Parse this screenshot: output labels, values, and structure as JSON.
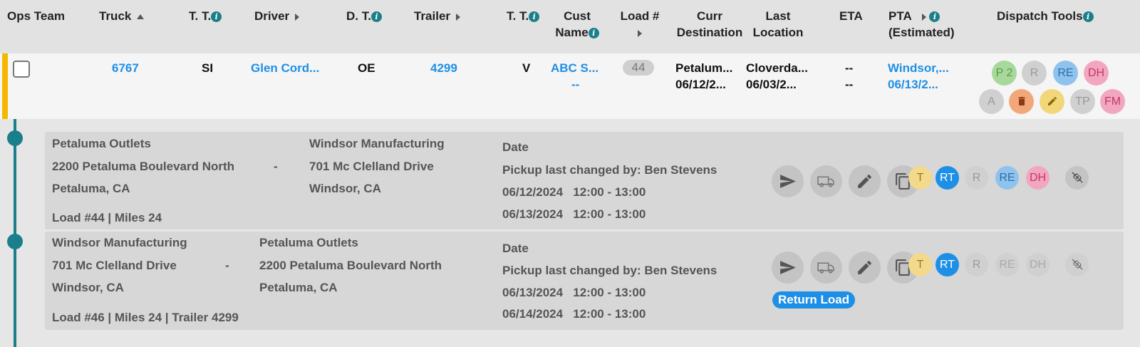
{
  "header": {
    "ops_team": "Ops Team",
    "truck": "Truck",
    "tt1": "T. T.",
    "driver": "Driver",
    "dt": "D. T.",
    "trailer": "Trailer",
    "tt2": "T. T.",
    "cust_name_1": "Cust",
    "cust_name_2": "Name",
    "load_num": "Load #",
    "curr_dest_1": "Curr",
    "curr_dest_2": "Destination",
    "last_loc_1": "Last",
    "last_loc_2": "Location",
    "eta": "ETA",
    "pta_1": "PTA",
    "pta_2": "(Estimated)",
    "dispatch_tools": "Dispatch Tools"
  },
  "row": {
    "truck": "6767",
    "tt1": "SI",
    "driver": "Glen Cord...",
    "dt": "OE",
    "trailer": "4299",
    "tt2": "V",
    "cust_name": "ABC S...",
    "cust_sub": "--",
    "load_num": "44",
    "curr_dest": "Petalum...",
    "curr_date": "06/12/2...",
    "last_loc": "Cloverda...",
    "last_date": "06/03/2...",
    "eta_1": "--",
    "eta_2": "--",
    "pta_loc": "Windsor,...",
    "pta_date": "06/13/2..."
  },
  "dispatch_pills": [
    {
      "label": "P 2",
      "bg": "#a8d89a",
      "fg": "#5a9a48"
    },
    {
      "label": "R",
      "bg": "#d0d0d0",
      "fg": "#999999"
    },
    {
      "label": "RE",
      "bg": "#8fc3ee",
      "fg": "#2a6ea8"
    },
    {
      "label": "DH",
      "bg": "#f2a6c0",
      "fg": "#c03a6a"
    },
    {
      "label": "A",
      "bg": "#d0d0d0",
      "fg": "#999999"
    },
    {
      "label": "trash-icon",
      "bg": "#f2a77a",
      "fg": "#a0522d"
    },
    {
      "label": "pencil-icon",
      "bg": "#f2d77a",
      "fg": "#8a6a00"
    },
    {
      "label": "TP",
      "bg": "#d0d0d0",
      "fg": "#999999"
    },
    {
      "label": "FM",
      "bg": "#f2a6c0",
      "fg": "#c03a6a"
    }
  ],
  "stops": [
    {
      "from_name": "Petaluma Outlets",
      "from_street": "2200 Petaluma Boulevard North",
      "from_city": "Petaluma, CA",
      "dash": "-",
      "to_name": "Windsor Manufacturing",
      "to_street": "701 Mc Clelland Drive",
      "to_city": "Windsor, CA",
      "meta": "Load #44 | Miles 24",
      "date_label": "Date",
      "changed_by": "Pickup last changed by: Ben Stevens",
      "date_1": "06/12/2024   12:00 - 13:00",
      "date_2": "06/13/2024   12:00 - 13:00",
      "pills": [
        {
          "label": "T",
          "bg": "#f2d98c",
          "fg": "#9a7a20"
        },
        {
          "label": "RT",
          "bg": "#1e8fe6",
          "fg": "#ffffff"
        },
        {
          "label": "R",
          "bg": "#d0d0d0",
          "fg": "#999999"
        },
        {
          "label": "RE",
          "bg": "#8fc3ee",
          "fg": "#2a6ea8"
        },
        {
          "label": "DH",
          "bg": "#f2a6c0",
          "fg": "#c03a6a"
        }
      ]
    },
    {
      "from_name": "Windsor Manufacturing",
      "from_street": "701 Mc Clelland Drive",
      "from_city": "Windsor, CA",
      "dash": "-",
      "to_name": "Petaluma Outlets",
      "to_street": "2200 Petaluma Boulevard North",
      "to_city": "Petaluma, CA",
      "meta": "Load #46 | Miles 24 | Trailer 4299",
      "date_label": "Date",
      "changed_by": "Pickup last changed by: Ben Stevens",
      "date_1": "06/13/2024   12:00 - 13:00",
      "date_2": "06/14/2024   12:00 - 13:00",
      "pills": [
        {
          "label": "T",
          "bg": "#f2d98c",
          "fg": "#9a7a20"
        },
        {
          "label": "RT",
          "bg": "#1e8fe6",
          "fg": "#ffffff"
        },
        {
          "label": "R",
          "bg": "#d0d0d0",
          "fg": "#999999"
        },
        {
          "label": "RE",
          "bg": "#d0d0d0",
          "fg": "#aaaaaa"
        },
        {
          "label": "DH",
          "bg": "#d0d0d0",
          "fg": "#aaaaaa"
        }
      ],
      "return_load": "Return Load"
    }
  ],
  "colors": {
    "accent_link": "#1e8fe6",
    "timeline": "#1a7f8a",
    "row_marker": "#f5b800"
  }
}
